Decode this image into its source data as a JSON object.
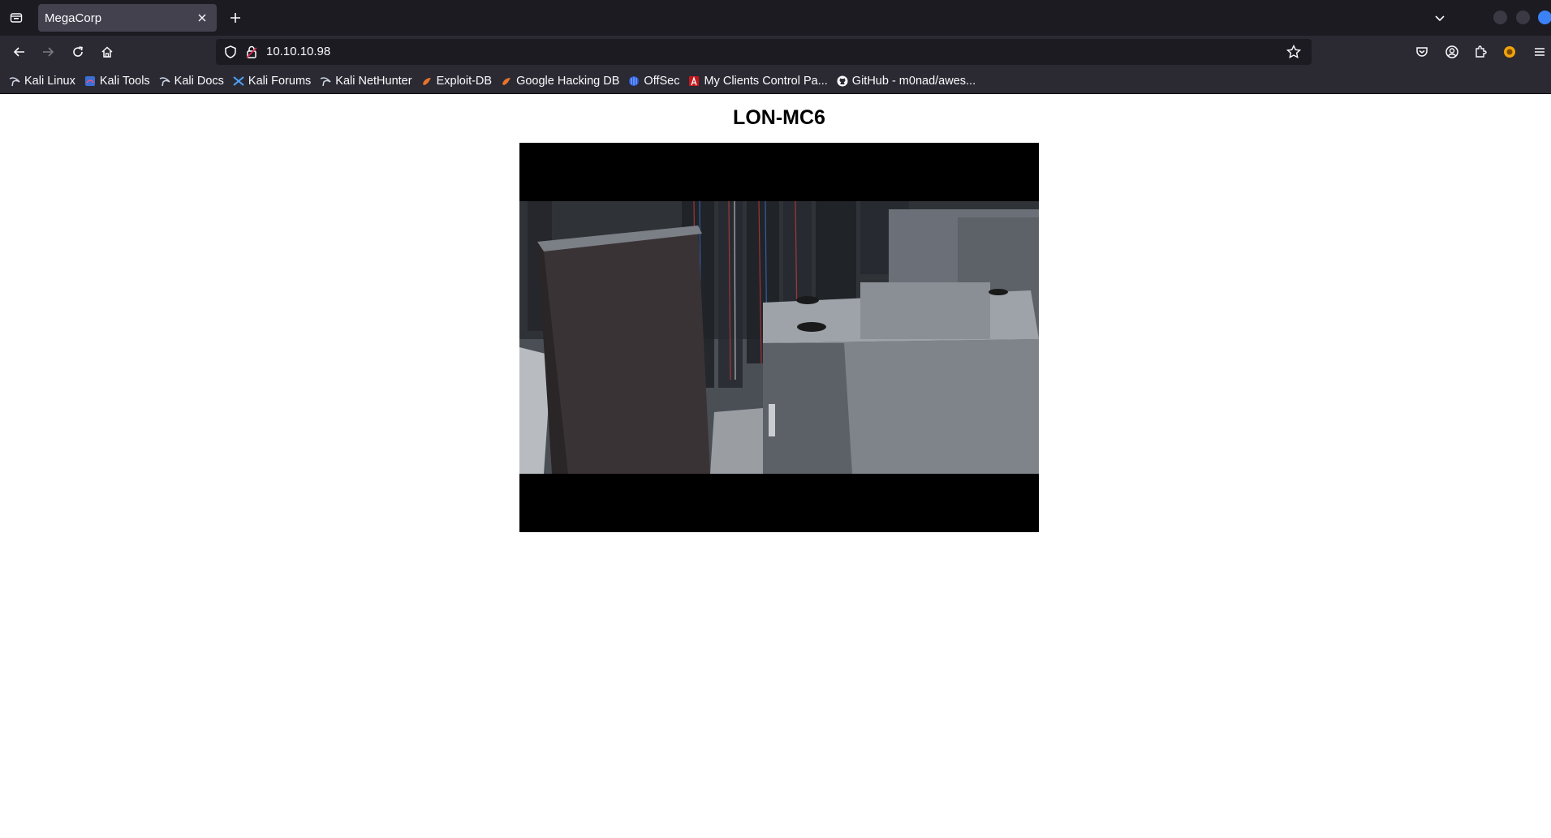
{
  "browser": {
    "tab_title": "MegaCorp",
    "url": "10.10.10.98"
  },
  "bookmarks": [
    {
      "label": "Kali Linux",
      "icon": "kali-dragon-icon"
    },
    {
      "label": "Kali Tools",
      "icon": "kali-tools-icon"
    },
    {
      "label": "Kali Docs",
      "icon": "kali-dragon-icon"
    },
    {
      "label": "Kali Forums",
      "icon": "kali-forums-icon"
    },
    {
      "label": "Kali NetHunter",
      "icon": "kali-dragon-icon"
    },
    {
      "label": "Exploit-DB",
      "icon": "exploit-db-icon"
    },
    {
      "label": "Google Hacking DB",
      "icon": "exploit-db-icon"
    },
    {
      "label": "OffSec",
      "icon": "offsec-icon"
    },
    {
      "label": "My Clients Control Pa...",
      "icon": "clients-icon"
    },
    {
      "label": "GitHub - m0nad/awes...",
      "icon": "github-icon"
    }
  ],
  "page": {
    "title": "LON-MC6"
  },
  "colors": {
    "tabbar_bg": "#1c1b22",
    "toolbar_bg": "#2b2a33",
    "accent": "#3b82f6"
  }
}
